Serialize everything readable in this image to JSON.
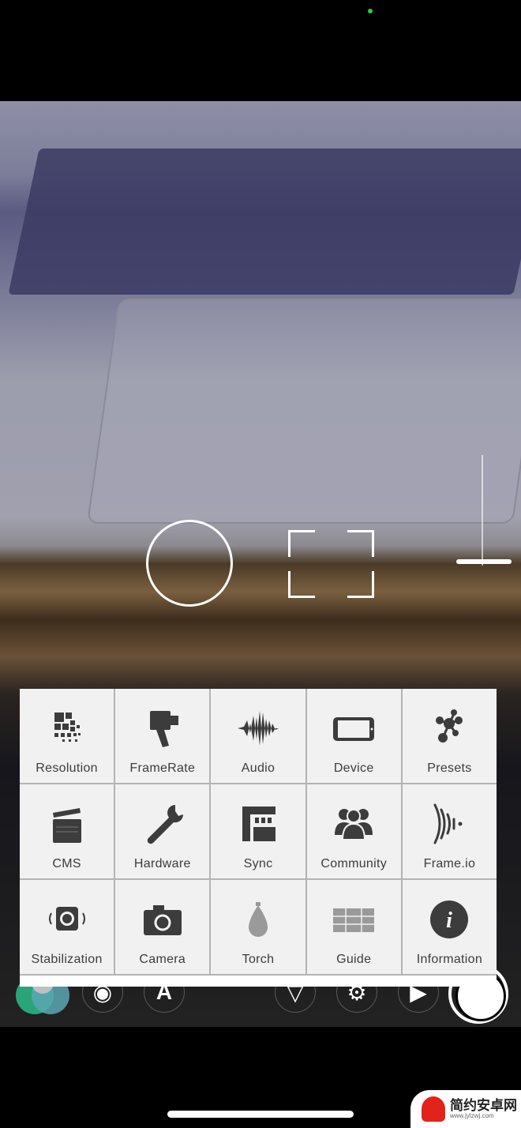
{
  "menu": {
    "items": [
      {
        "label": "Resolution",
        "icon": "resolution-icon"
      },
      {
        "label": "FrameRate",
        "icon": "movie-camera-icon"
      },
      {
        "label": "Audio",
        "icon": "waveform-icon"
      },
      {
        "label": "Device",
        "icon": "phone-landscape-icon"
      },
      {
        "label": "Presets",
        "icon": "molecule-icon"
      },
      {
        "label": "CMS",
        "icon": "clapperboard-icon"
      },
      {
        "label": "Hardware",
        "icon": "wrench-icon"
      },
      {
        "label": "Sync",
        "icon": "sync-icon"
      },
      {
        "label": "Community",
        "icon": "people-icon"
      },
      {
        "label": "Frame.io",
        "icon": "signal-waves-icon"
      },
      {
        "label": "Stabilization",
        "icon": "stabilization-icon"
      },
      {
        "label": "Camera",
        "icon": "camera-switch-icon"
      },
      {
        "label": "Torch",
        "icon": "bulb-icon"
      },
      {
        "label": "Guide",
        "icon": "grid-guide-icon"
      },
      {
        "label": "Information",
        "icon": "info-icon"
      }
    ]
  },
  "watermark": {
    "title": "简约安卓网",
    "url": "www.jylzwj.com"
  },
  "colors": {
    "menu_bg": "#f1f1f1",
    "icon": "#3c3c3c",
    "status_dot": "#2ecc40"
  }
}
